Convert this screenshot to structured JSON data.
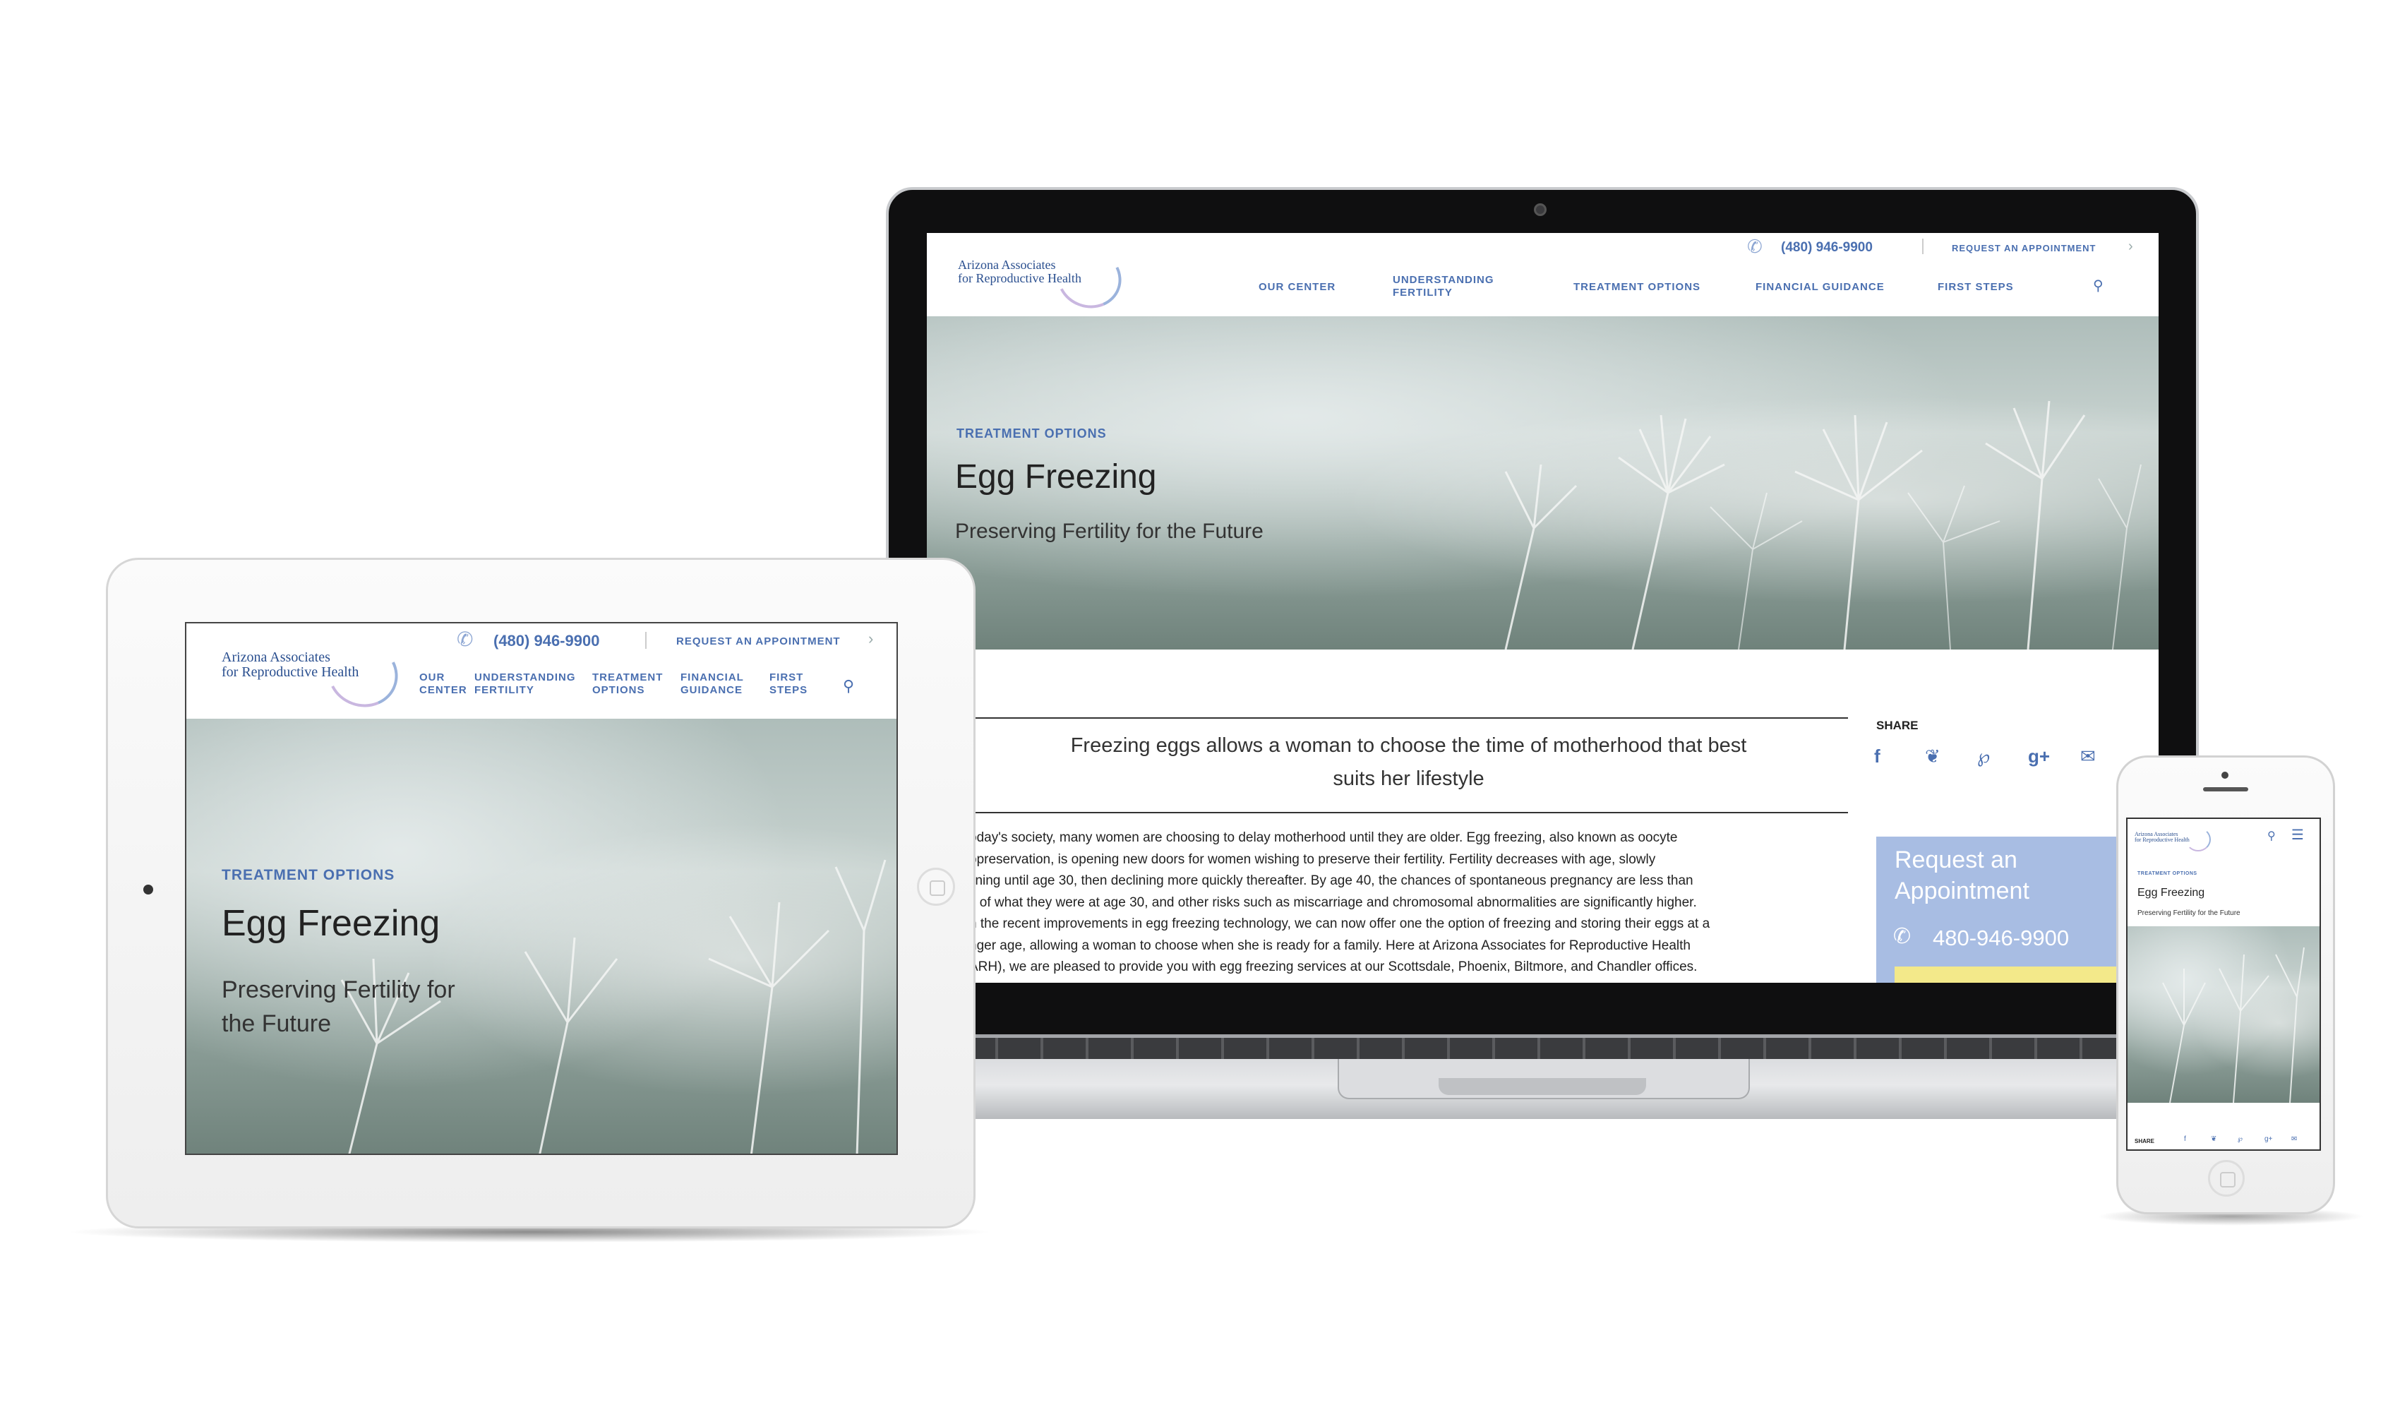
{
  "site": {
    "logo_line1": "Arizona Associates",
    "logo_line2": "for Reproductive Health",
    "phone": "(480) 946-9900",
    "request_link": "REQUEST AN APPOINTMENT",
    "nav": {
      "our_center_1": "OUR",
      "our_center_2": "CENTER",
      "our_center": "OUR CENTER",
      "understanding_1": "UNDERSTANDING",
      "understanding_2": "FERTILITY",
      "treatment_1": "TREATMENT",
      "treatment_2": "OPTIONS",
      "treatment": "TREATMENT OPTIONS",
      "financial_1": "FINANCIAL",
      "financial_2": "GUIDANCE",
      "financial": "FINANCIAL GUIDANCE",
      "first_1": "FIRST",
      "first_2": "STEPS",
      "first": "FIRST STEPS"
    }
  },
  "hero": {
    "eyebrow": "TREATMENT OPTIONS",
    "title": "Egg Freezing",
    "subtitle": "Preserving Fertility for the Future",
    "subtitle_line1": "Preserving Fertility for",
    "subtitle_line2": "the Future"
  },
  "article": {
    "pull_quote_1": "Freezing eggs allows a woman to choose the time of motherhood that best",
    "pull_quote_2": "suits her lifestyle",
    "lines": [
      "oday's society, many women are choosing to delay motherhood until they are older. Egg freezing, also known as oocyte",
      "opreservation, is opening new doors for women wishing to preserve their fertility.  Fertility decreases with age, slowly",
      "lining until age 30, then declining more quickly thereafter. By age 40, the chances of spontaneous pregnancy are less than",
      "s of what they were at age 30, and other risks such as miscarriage and chromosomal abnormalities are significantly higher.",
      "h the recent improvements in egg freezing technology, we can now offer one the option of freezing and storing their eggs at a",
      "nger age, allowing a woman to choose when she is ready for a family. Here at Arizona Associates for Reproductive Health",
      "ARH), we are pleased to provide you with egg freezing services at our Scottsdale, Phoenix, Biltmore, and Chandler offices."
    ]
  },
  "sidebar": {
    "share_label": "SHARE",
    "request_line1": "Request an",
    "request_line2": "Appointment",
    "phone": "480-946-9900"
  },
  "phone_screen": {
    "share_label": "SHARE"
  },
  "colors": {
    "brand_blue": "#4a6fb0",
    "appointment_box": "#a8bde3",
    "appointment_stripe": "#f3e98a"
  },
  "icons": [
    "phone-icon",
    "search-icon",
    "chevron-right-icon",
    "facebook-icon",
    "twitter-icon",
    "pinterest-icon",
    "google-plus-icon",
    "mail-icon",
    "menu-icon",
    "camera-icon",
    "home-button-icon"
  ]
}
